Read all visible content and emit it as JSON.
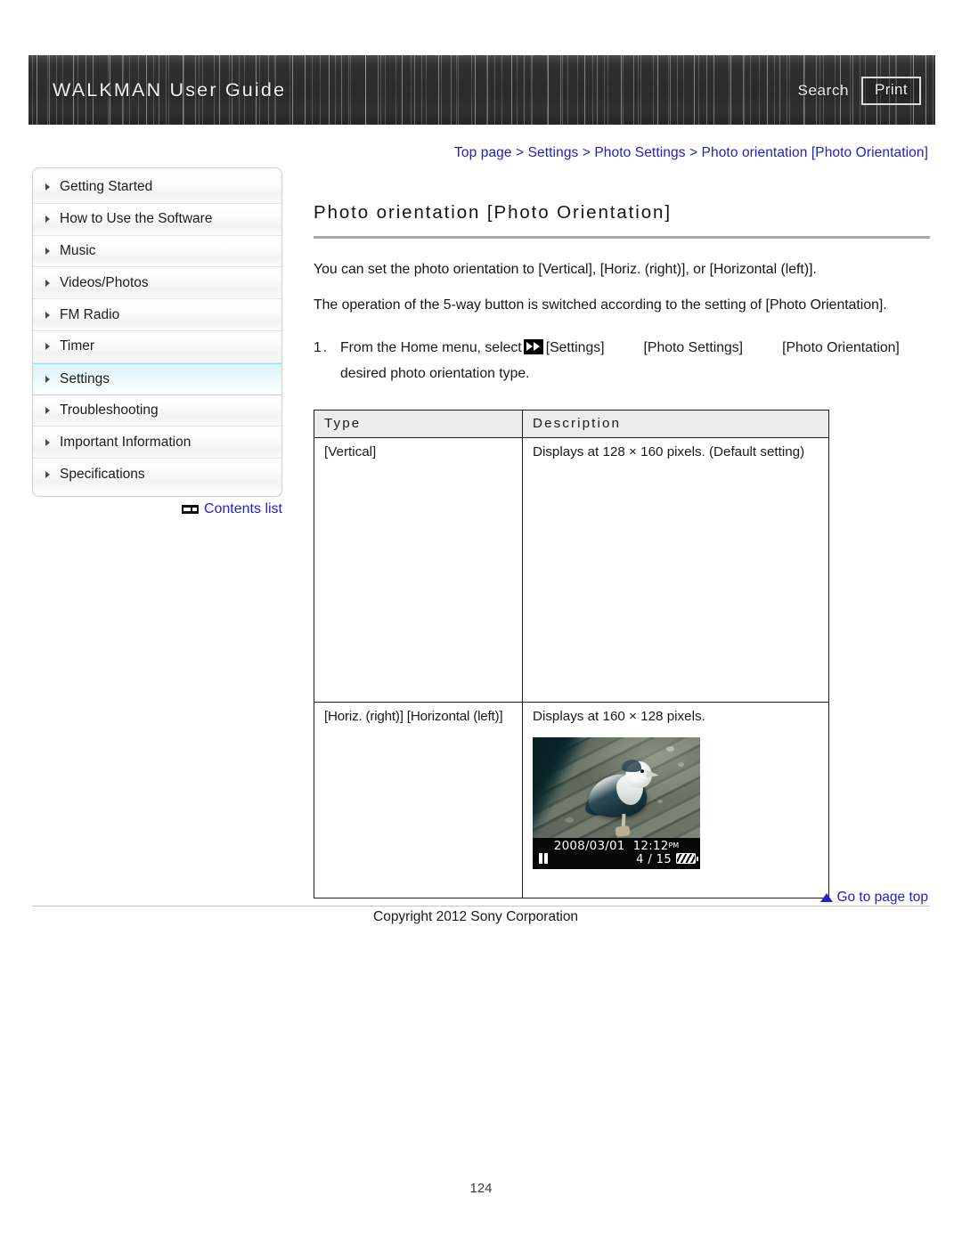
{
  "header": {
    "title": "WALKMAN User Guide",
    "search_label": "Search",
    "print_label": "Print"
  },
  "breadcrumb": {
    "text": "Top page > Settings > Photo Settings > Photo orientation [Photo Orientation]"
  },
  "sidebar": {
    "items": [
      {
        "label": "Getting Started",
        "selected": false
      },
      {
        "label": "How to Use the Software",
        "selected": false
      },
      {
        "label": "Music",
        "selected": false
      },
      {
        "label": "Videos/Photos",
        "selected": false
      },
      {
        "label": "FM Radio",
        "selected": false
      },
      {
        "label": "Timer",
        "selected": false
      },
      {
        "label": "Settings",
        "selected": true
      },
      {
        "label": "Troubleshooting",
        "selected": false
      },
      {
        "label": "Important Information",
        "selected": false
      },
      {
        "label": "Specifications",
        "selected": false
      }
    ],
    "contents_list_label": "Contents list"
  },
  "main": {
    "heading": "Photo orientation [Photo Orientation]",
    "paragraph_1": "You can set the photo orientation to [Vertical], [Horiz. (right)], or [Horizontal (left)].",
    "paragraph_2": "The operation of the 5-way button is switched according to the setting of [Photo Orientation].",
    "step": {
      "number": "1.",
      "lead": "From the Home menu, select",
      "settings_label": "[Settings]",
      "photo_settings_label": "[Photo Settings]",
      "photo_orientation_label": "[Photo Orientation]",
      "continuation": "desired photo orientation type."
    },
    "table": {
      "columns": [
        "Type",
        "Description"
      ],
      "rows": [
        {
          "type": "[Vertical]",
          "description": "Displays at 128 × 160 pixels. (Default setting)",
          "has_photo": false
        },
        {
          "type": "[Horiz. (right)] [Horizontal (left)]",
          "description": "Displays at 160 × 128 pixels.",
          "has_photo": true
        }
      ]
    },
    "photo_osd": {
      "date": "2008/03/01",
      "time": "12:12",
      "ampm": "PM",
      "counter": "4 / 15"
    }
  },
  "footer": {
    "go_to_top": "Go to page top",
    "copyright": "Copyright 2012 Sony Corporation",
    "page_number": "124"
  }
}
